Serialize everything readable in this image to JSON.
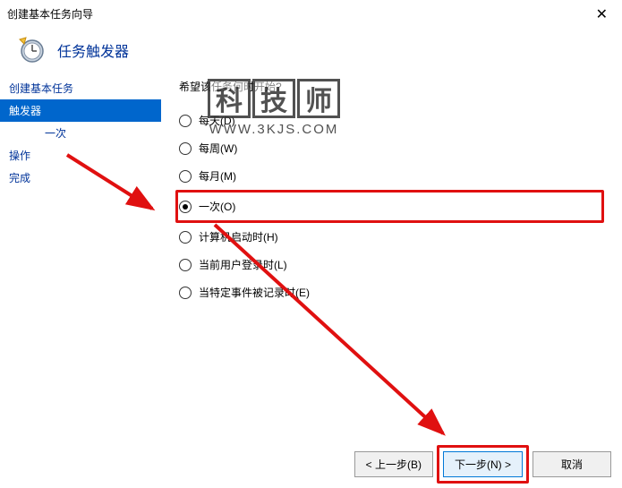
{
  "window": {
    "title": "创建基本任务向导",
    "close": "✕"
  },
  "header": {
    "title": "任务触发器"
  },
  "sidebar": {
    "items": [
      {
        "label": "创建基本任务"
      },
      {
        "label": "触发器"
      },
      {
        "label": "一次"
      },
      {
        "label": "操作"
      },
      {
        "label": "完成"
      }
    ]
  },
  "main": {
    "prompt": "希望该任务何时开始?",
    "options": [
      {
        "label": "每天(D)",
        "checked": false
      },
      {
        "label": "每周(W)",
        "checked": false
      },
      {
        "label": "每月(M)",
        "checked": false
      },
      {
        "label": "一次(O)",
        "checked": true
      },
      {
        "label": "计算机启动时(H)",
        "checked": false
      },
      {
        "label": "当前用户登录时(L)",
        "checked": false
      },
      {
        "label": "当特定事件被记录时(E)",
        "checked": false
      }
    ]
  },
  "footer": {
    "back": "< 上一步(B)",
    "next": "下一步(N) >",
    "cancel": "取消"
  },
  "watermark": {
    "chars": [
      "科",
      "技",
      "师"
    ],
    "url": "WWW.3KJS.COM"
  }
}
